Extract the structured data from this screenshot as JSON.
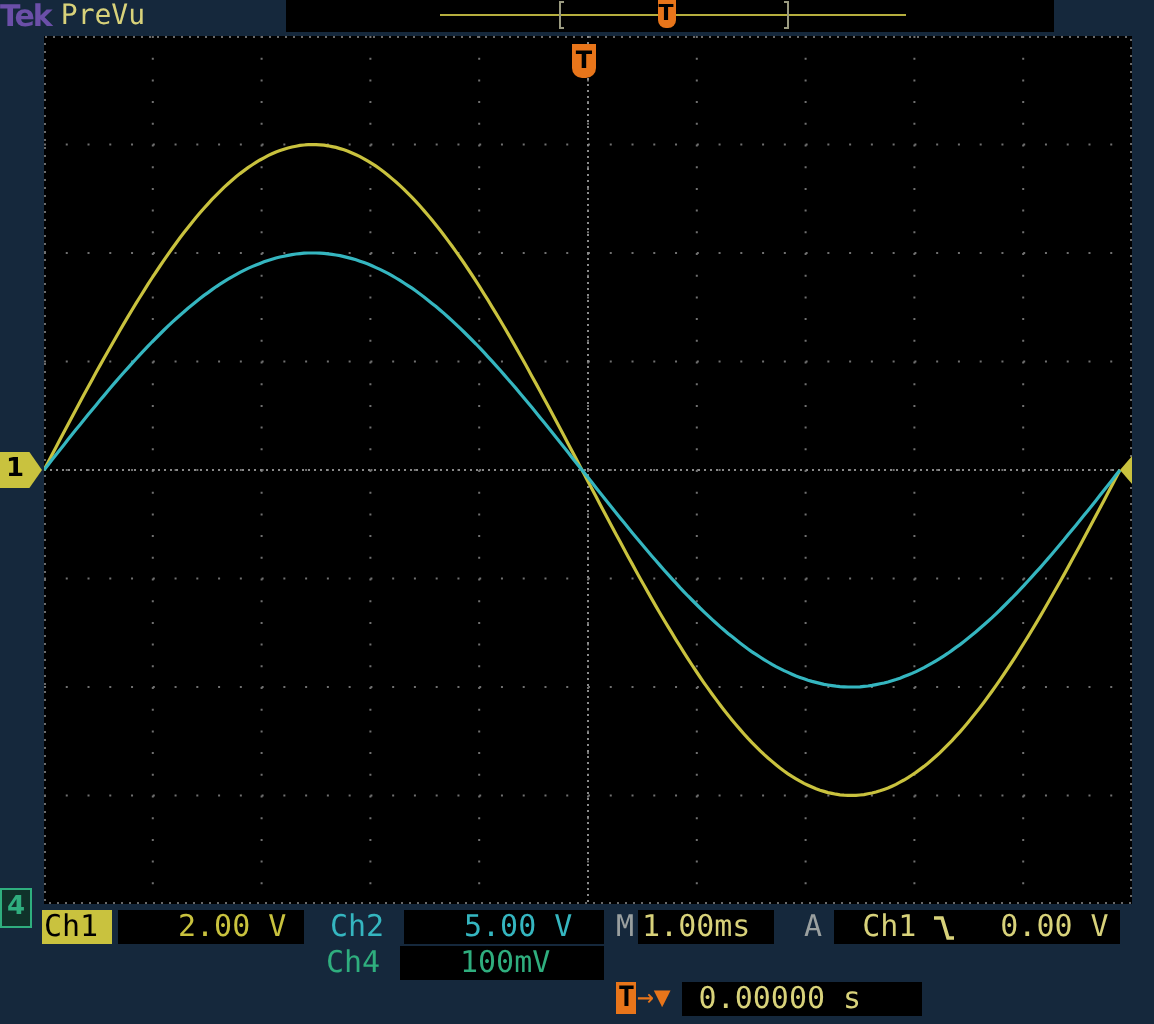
{
  "header": {
    "brand": "Tek",
    "mode": "PreVu",
    "record_marker": "T"
  },
  "graticule": {
    "trigger_marker": "T",
    "channel_markers": [
      {
        "label": "1",
        "color": "#c9c23e",
        "kind": "side"
      },
      {
        "label": "4",
        "color": "#2fae7e",
        "kind": "corner"
      }
    ]
  },
  "status": {
    "channels": [
      {
        "label": "Ch1",
        "scale": "2.00 V",
        "color": "#c9c23e",
        "selected": true
      },
      {
        "label": "Ch2",
        "scale": "5.00 V",
        "color": "#35b6c0",
        "selected": false
      },
      {
        "label": "Ch4",
        "scale": "100mV",
        "color": "#2fae7e",
        "selected": false
      }
    ],
    "timebase": {
      "label": "M",
      "value": "1.00ms"
    },
    "trigger": {
      "label": "A",
      "source": "Ch1",
      "level": "0.00 V"
    },
    "trigger_position": {
      "marker": "T",
      "arrow": "→▼",
      "value": "0.00000 s"
    }
  }
}
